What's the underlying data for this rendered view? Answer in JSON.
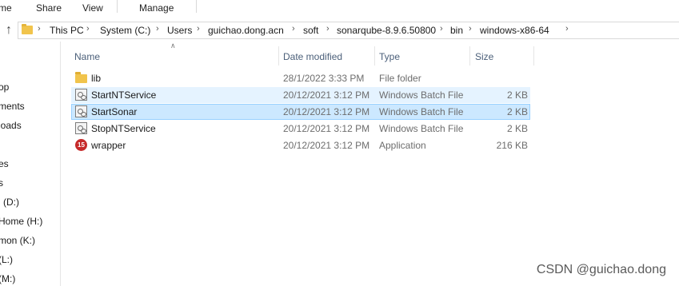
{
  "ribbon": {
    "tabs": [
      "me",
      "Share",
      "View",
      "Manage"
    ]
  },
  "address": {
    "segments": [
      "This PC",
      "System (C:)",
      "Users",
      "guichao.dong.acn",
      "soft",
      "sonarqube-8.9.6.50800",
      "bin",
      "windows-x86-64"
    ]
  },
  "nav": {
    "items": [
      "",
      "op",
      "ments",
      "loads",
      "",
      "es",
      "s",
      "l (D:)",
      "Home (H:)",
      "mon (K:)",
      "(L:)",
      "(M:)"
    ]
  },
  "columns": {
    "name": "Name",
    "date": "Date modified",
    "type": "Type",
    "size": "Size"
  },
  "files": [
    {
      "name": "lib",
      "date": "28/1/2022 3:33 PM",
      "type": "File folder",
      "size": "",
      "icon": "folder-icon",
      "state": "normal"
    },
    {
      "name": "StartNTService",
      "date": "20/12/2021 3:12 PM",
      "type": "Windows Batch File",
      "size": "2 KB",
      "icon": "batch-file-icon",
      "state": "hover"
    },
    {
      "name": "StartSonar",
      "date": "20/12/2021 3:12 PM",
      "type": "Windows Batch File",
      "size": "2 KB",
      "icon": "batch-file-icon",
      "state": "selected"
    },
    {
      "name": "StopNTService",
      "date": "20/12/2021 3:12 PM",
      "type": "Windows Batch File",
      "size": "2 KB",
      "icon": "batch-file-icon",
      "state": "normal"
    },
    {
      "name": "wrapper",
      "date": "20/12/2021 3:12 PM",
      "type": "Application",
      "size": "216 KB",
      "icon": "application-icon",
      "state": "normal",
      "badge": "15"
    }
  ],
  "watermark": "CSDN @guichao.dong",
  "colors": {
    "hover": "#e5f3ff",
    "selected": "#cce8ff",
    "selected_border": "#99d1ff",
    "header_text": "#4c607a"
  }
}
